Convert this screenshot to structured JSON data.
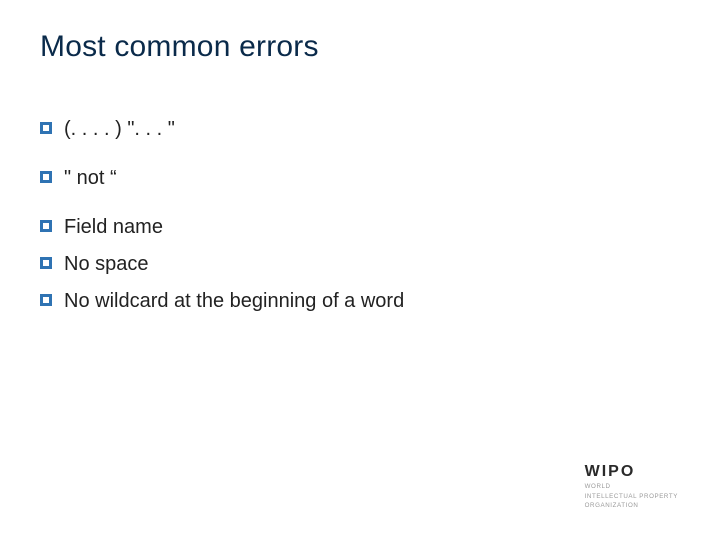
{
  "title": "Most common errors",
  "bullets": {
    "b0": "(. . . . )   \". . . \"",
    "b1": "\"   not  “",
    "b2": "Field name",
    "b3": "No space",
    "b4": "No wildcard at the beginning of a word"
  },
  "footer": {
    "brand": "WIPO",
    "line1": "WORLD",
    "line2": "INTELLECTUAL PROPERTY",
    "line3": "ORGANIZATION"
  }
}
